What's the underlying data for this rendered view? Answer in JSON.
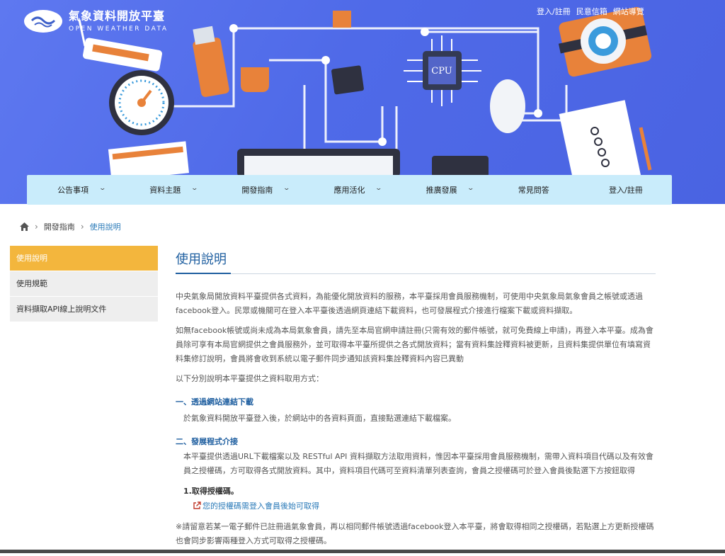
{
  "brand": {
    "title": "氣象資料開放平臺",
    "subtitle": "OPEN WEATHER DATA"
  },
  "toplinks": [
    "登入/註冊",
    "民意信箱",
    "網站導覽"
  ],
  "hero_art": {
    "cpu_label": "CPU"
  },
  "nav": [
    {
      "label": "公告事項",
      "has_menu": true
    },
    {
      "label": "資料主題",
      "has_menu": true
    },
    {
      "label": "開發指南",
      "has_menu": true
    },
    {
      "label": "應用活化",
      "has_menu": true
    },
    {
      "label": "推廣發展",
      "has_menu": true
    },
    {
      "label": "常見問答",
      "has_menu": false
    },
    {
      "label": "登入/註冊",
      "has_menu": false
    }
  ],
  "breadcrumb": {
    "parent": "開發指南",
    "current": "使用說明"
  },
  "sidebar": [
    {
      "label": "使用說明",
      "active": true
    },
    {
      "label": "使用規範",
      "active": false
    },
    {
      "label": "資料擷取API線上說明文件",
      "active": false
    }
  ],
  "content": {
    "title": "使用說明",
    "p1": "中央氣象局開放資料平臺提供各式資料，為能優化開放資料的服務，本平臺採用會員服務機制，可使用中央氣象局氣象會員之帳號或透過facebook登入。民眾或機關可在登入本平臺後透過網頁連結下載資料，也可發展程式介接進行檔案下載或資料擷取。",
    "p2": "如無facebook帳號或尚未成為本局氣象會員，請先至本局官網申請註冊(只需有效的郵件帳號，就可免費線上申請)，再登入本平臺。成為會員除可享有本局官網提供之會員服務外，並可取得本平臺所提供之各式開放資料；當有資料集詮釋資料被更新，且資料集提供單位有填寫資料集修訂說明，會員將會收到系統以電子郵件同步通知該資料集詮釋資料內容已異動",
    "p3": "以下分別說明本平臺提供之資料取用方式：",
    "h1": "一、透過網站連結下載",
    "h1_text": "於氣象資料開放平臺登入後，於網站中的各資料頁面，直接點選連結下載檔案。",
    "h2": "二、發展程式介接",
    "h2_text": "本平臺提供透過URL下載檔案以及 RESTful API 資料擷取方法取用資料，惟因本平臺採用會員服務機制，需帶入資料項目代碼以及有效會員之授權碼，方可取得各式開放資料。其中，資料項目代碼可至資料清單列表查詢，會員之授權碼可於登入會員後點選下方按鈕取得",
    "step1": "1.取得授權碼。",
    "auth_link": "您的授權碼需登入會員後始可取得",
    "note": "※請留意若某一電子郵件已註冊過氣象會員，再以相同郵件帳號透過facebook登入本平臺，將會取得相同之授權碼，若點選上方更新授權碼也會同步影響兩種登入方式可取得之授權碼。"
  }
}
